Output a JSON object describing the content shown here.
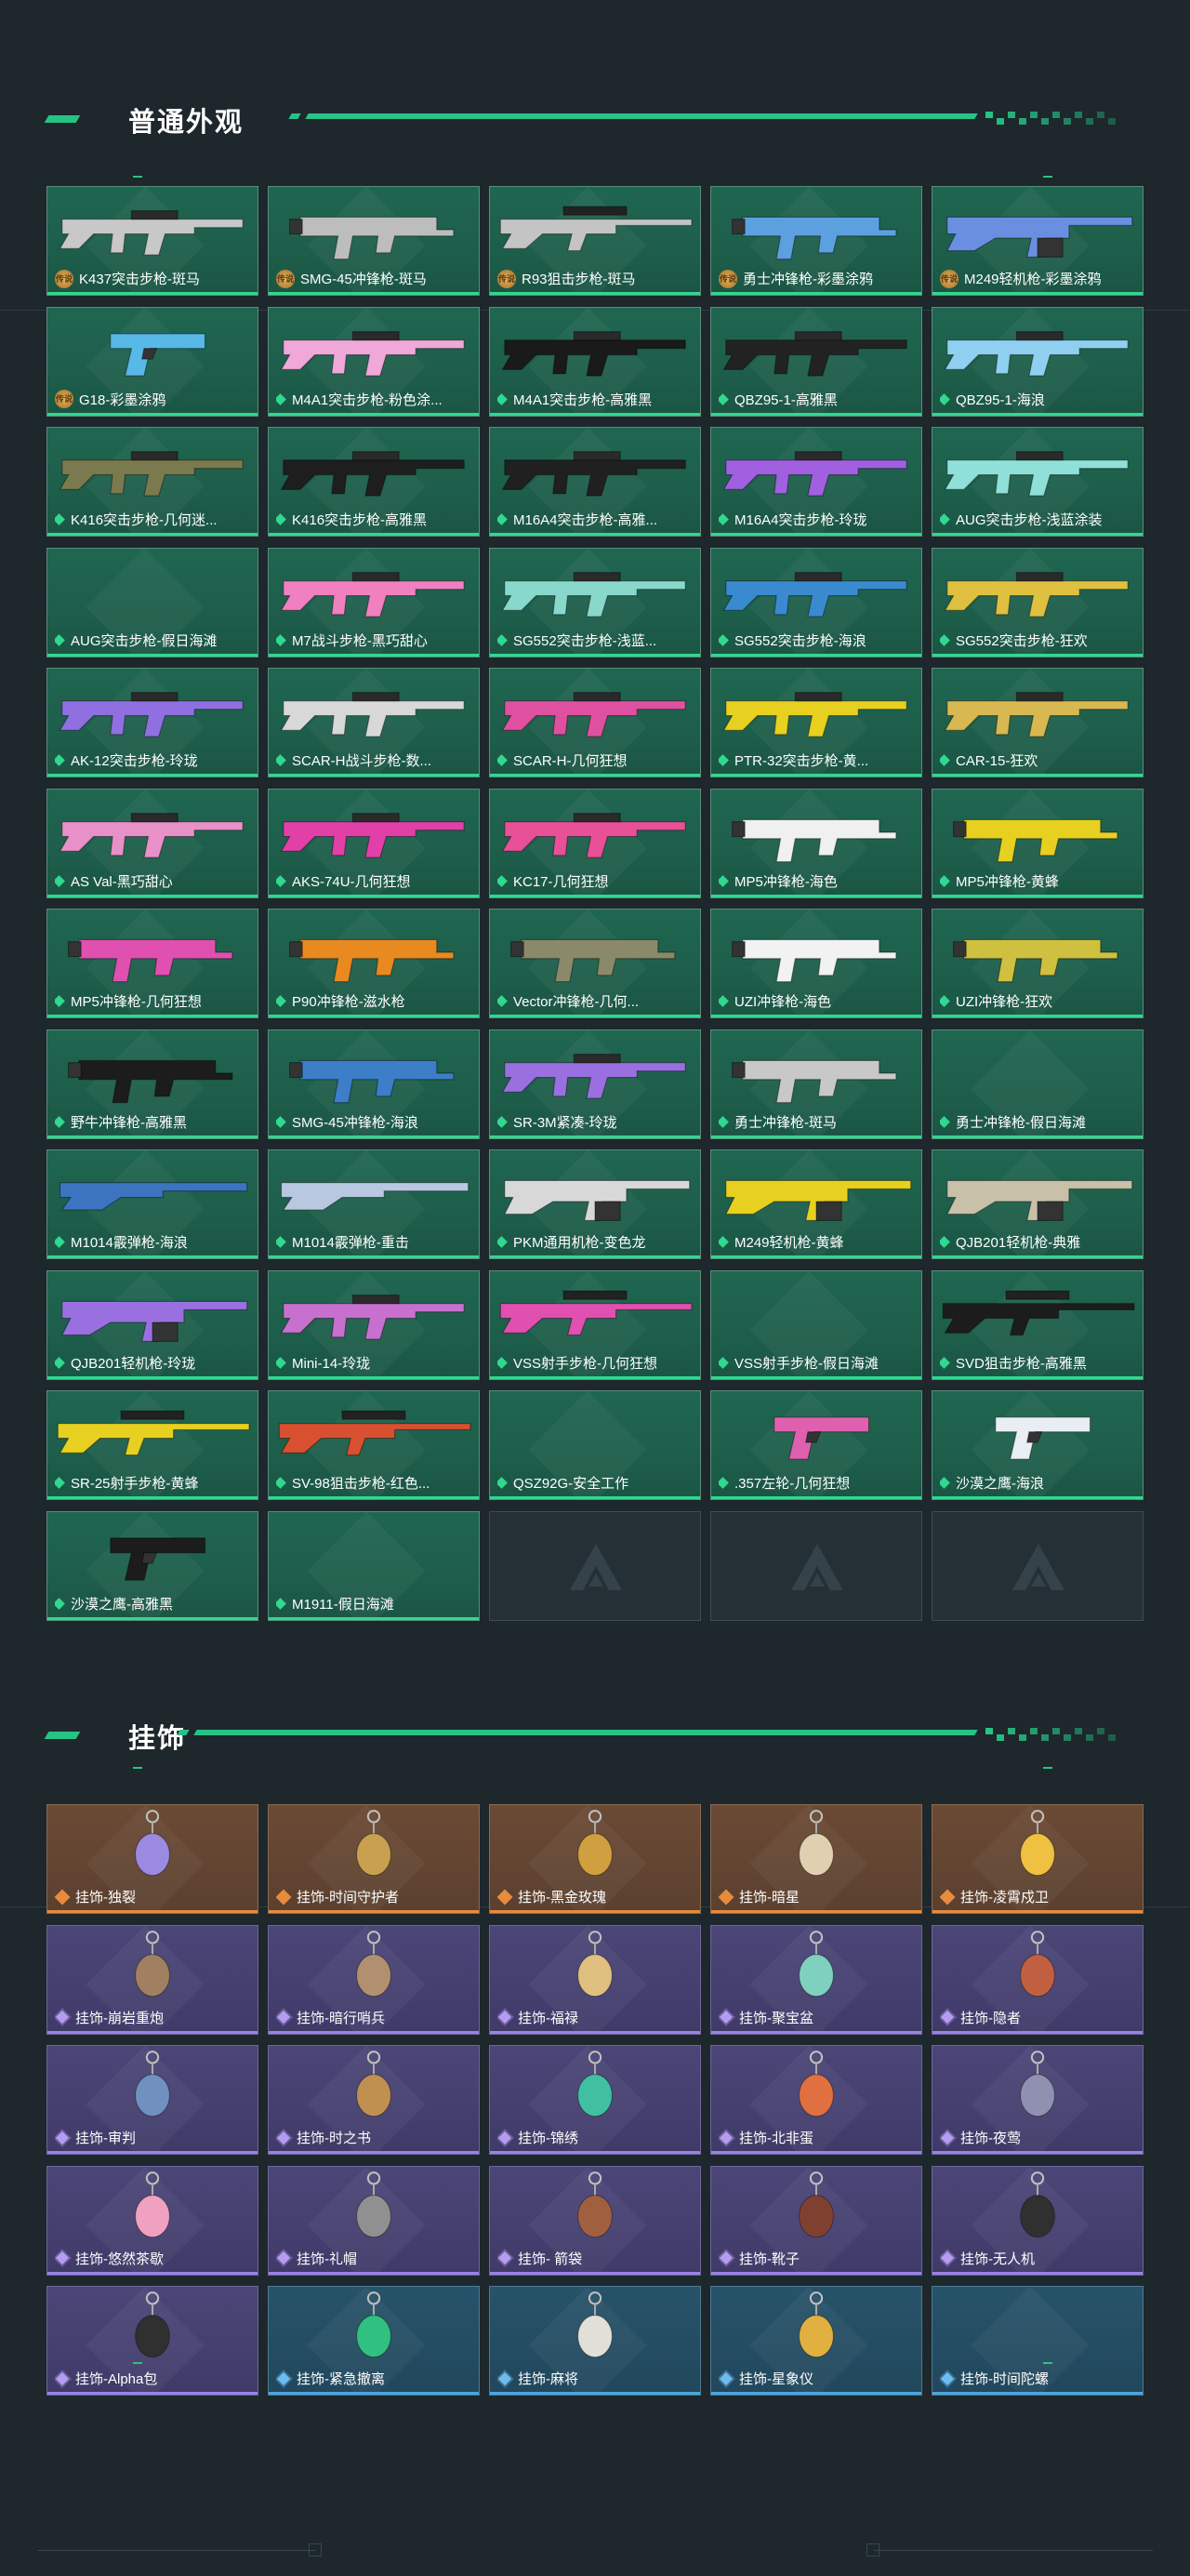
{
  "sections": {
    "skins_title": "普通外观",
    "charms_title": "挂饰"
  },
  "colors": {
    "accent_green": "#27c386",
    "card_green": "#1f6650",
    "card_orange": "#6b4a34",
    "card_purple": "#4c4678",
    "card_blue": "#27536a"
  },
  "skins": [
    {
      "label": "K437突击步枪-斑马",
      "tier": "legendary",
      "icon": "rifle-icon",
      "color": "#c8c8c8"
    },
    {
      "label": "SMG-45冲锋枪-斑马",
      "tier": "legendary",
      "icon": "smg-icon",
      "color": "#bdbdbd"
    },
    {
      "label": "R93狙击步枪-斑马",
      "tier": "legendary",
      "icon": "sniper-icon",
      "color": "#c4c4c4"
    },
    {
      "label": "勇士冲锋枪-彩墨涂鸦",
      "tier": "legendary",
      "icon": "smg-icon",
      "color": "#5da0e0"
    },
    {
      "label": "M249轻机枪-彩墨涂鸦",
      "tier": "legendary",
      "icon": "lmg-icon",
      "color": "#6a8fe0"
    },
    {
      "label": "G18-彩墨涂鸦",
      "tier": "legendary",
      "icon": "pistol-icon",
      "color": "#58b8e8"
    },
    {
      "label": "M4A1突击步枪-粉色涂...",
      "tier": "rare",
      "icon": "rifle-icon",
      "color": "#f0a8d8"
    },
    {
      "label": "M4A1突击步枪-高雅黑",
      "tier": "rare",
      "icon": "rifle-icon",
      "color": "#1a1a1a"
    },
    {
      "label": "QBZ95-1-高雅黑",
      "tier": "rare",
      "icon": "rifle-icon",
      "color": "#222222"
    },
    {
      "label": "QBZ95-1-海浪",
      "tier": "rare",
      "icon": "rifle-icon",
      "color": "#8fd0f0"
    },
    {
      "label": "K416突击步枪-几何迷...",
      "tier": "rare",
      "icon": "rifle-icon",
      "color": "#7a7a4e"
    },
    {
      "label": "K416突击步枪-高雅黑",
      "tier": "rare",
      "icon": "rifle-icon",
      "color": "#1e1e1e"
    },
    {
      "label": "M16A4突击步枪-高雅...",
      "tier": "rare",
      "icon": "rifle-icon",
      "color": "#202020"
    },
    {
      "label": "M16A4突击步枪-玲珑",
      "tier": "rare",
      "icon": "rifle-icon",
      "color": "#a060e0"
    },
    {
      "label": "AUG突击步枪-浅蓝涂装",
      "tier": "rare",
      "icon": "rifle-icon",
      "color": "#8fe0d8"
    },
    {
      "label": "AUG突击步枪-假日海滩",
      "tier": "rare",
      "icon": "rifle-icon",
      "color": ""
    },
    {
      "label": "M7战斗步枪-黑巧甜心",
      "tier": "rare",
      "icon": "rifle-icon",
      "color": "#f080c0"
    },
    {
      "label": "SG552突击步枪-浅蓝...",
      "tier": "rare",
      "icon": "rifle-icon",
      "color": "#88d8cc"
    },
    {
      "label": "SG552突击步枪-海浪",
      "tier": "rare",
      "icon": "rifle-icon",
      "color": "#3a8ad0"
    },
    {
      "label": "SG552突击步枪-狂欢",
      "tier": "rare",
      "icon": "rifle-icon",
      "color": "#e0c040"
    },
    {
      "label": "AK-12突击步枪-玲珑",
      "tier": "rare",
      "icon": "rifle-icon",
      "color": "#9070e0"
    },
    {
      "label": "SCAR-H战斗步枪-数...",
      "tier": "rare",
      "icon": "rifle-icon",
      "color": "#d8d8d8"
    },
    {
      "label": "SCAR-H-几何狂想",
      "tier": "rare",
      "icon": "rifle-icon",
      "color": "#e050a0"
    },
    {
      "label": "PTR-32突击步枪-黄...",
      "tier": "rare",
      "icon": "rifle-icon",
      "color": "#e8d020"
    },
    {
      "label": "CAR-15-狂欢",
      "tier": "rare",
      "icon": "rifle-icon",
      "color": "#d8b850"
    },
    {
      "label": "AS Val-黑巧甜心",
      "tier": "rare",
      "icon": "rifle-icon",
      "color": "#e890c8"
    },
    {
      "label": "AKS-74U-几何狂想",
      "tier": "rare",
      "icon": "rifle-icon",
      "color": "#e040a8"
    },
    {
      "label": "KC17-几何狂想",
      "tier": "rare",
      "icon": "rifle-icon",
      "color": "#e85098"
    },
    {
      "label": "MP5冲锋枪-海色",
      "tier": "rare",
      "icon": "smg-icon",
      "color": "#f0f0f0"
    },
    {
      "label": "MP5冲锋枪-黄蜂",
      "tier": "rare",
      "icon": "smg-icon",
      "color": "#e8d020"
    },
    {
      "label": "MP5冲锋枪-几何狂想",
      "tier": "rare",
      "icon": "smg-icon",
      "color": "#e050b0"
    },
    {
      "label": "P90冲锋枪-滋水枪",
      "tier": "rare",
      "icon": "smg-icon",
      "color": "#e88a20"
    },
    {
      "label": "Vector冲锋枪-几何...",
      "tier": "rare",
      "icon": "smg-icon",
      "color": "#8a8a6a"
    },
    {
      "label": "UZI冲锋枪-海色",
      "tier": "rare",
      "icon": "smg-icon",
      "color": "#f2f2f2"
    },
    {
      "label": "UZI冲锋枪-狂欢",
      "tier": "rare",
      "icon": "smg-icon",
      "color": "#d0c040"
    },
    {
      "label": "野牛冲锋枪-高雅黑",
      "tier": "rare",
      "icon": "smg-icon",
      "color": "#1c1c1c"
    },
    {
      "label": "SMG-45冲锋枪-海浪",
      "tier": "rare",
      "icon": "smg-icon",
      "color": "#3c7ec8"
    },
    {
      "label": "SR-3M紧凑-玲珑",
      "tier": "rare",
      "icon": "rifle-icon",
      "color": "#9a70e0"
    },
    {
      "label": "勇士冲锋枪-斑马",
      "tier": "rare",
      "icon": "smg-icon",
      "color": "#c8c8c8"
    },
    {
      "label": "勇士冲锋枪-假日海滩",
      "tier": "rare",
      "icon": "smg-icon",
      "color": ""
    },
    {
      "label": "M1014霰弹枪-海浪",
      "tier": "rare",
      "icon": "shotgun-icon",
      "color": "#3c74c0"
    },
    {
      "label": "M1014霰弹枪-重击",
      "tier": "rare",
      "icon": "shotgun-icon",
      "color": "#b8c8e0"
    },
    {
      "label": "PKM通用机枪-变色龙",
      "tier": "rare",
      "icon": "lmg-icon",
      "color": "#d8d8d8"
    },
    {
      "label": "M249轻机枪-黄蜂",
      "tier": "rare",
      "icon": "lmg-icon",
      "color": "#e8d020"
    },
    {
      "label": "QJB201轻机枪-典雅",
      "tier": "rare",
      "icon": "lmg-icon",
      "color": "#c8c0a8"
    },
    {
      "label": "QJB201轻机枪-玲珑",
      "tier": "rare",
      "icon": "lmg-icon",
      "color": "#9a70e0"
    },
    {
      "label": "Mini-14-玲珑",
      "tier": "rare",
      "icon": "rifle-icon",
      "color": "#c870d0"
    },
    {
      "label": "VSS射手步枪-几何狂想",
      "tier": "rare",
      "icon": "sniper-icon",
      "color": "#e050b0"
    },
    {
      "label": "VSS射手步枪-假日海滩",
      "tier": "rare",
      "icon": "sniper-icon",
      "color": ""
    },
    {
      "label": "SVD狙击步枪-高雅黑",
      "tier": "rare",
      "icon": "sniper-icon",
      "color": "#1c1c1c"
    },
    {
      "label": "SR-25射手步枪-黄蜂",
      "tier": "rare",
      "icon": "sniper-icon",
      "color": "#e8d020"
    },
    {
      "label": "SV-98狙击步枪-红色...",
      "tier": "rare",
      "icon": "sniper-icon",
      "color": "#d85030"
    },
    {
      "label": "QSZ92G-安全工作",
      "tier": "rare",
      "icon": "pistol-icon",
      "color": ""
    },
    {
      "label": ".357左轮-几何狂想",
      "tier": "rare",
      "icon": "revolver-icon",
      "color": "#e060b0"
    },
    {
      "label": "沙漠之鹰-海浪",
      "tier": "rare",
      "icon": "pistol-icon",
      "color": "#e8eef4"
    },
    {
      "label": "沙漠之鹰-高雅黑",
      "tier": "rare",
      "icon": "pistol-icon",
      "color": "#1c1c1c"
    },
    {
      "label": "M1911-假日海滩",
      "tier": "rare",
      "icon": "pistol-icon",
      "color": ""
    },
    {
      "label": "",
      "tier": "empty",
      "icon": "",
      "color": ""
    },
    {
      "label": "",
      "tier": "empty",
      "icon": "",
      "color": ""
    },
    {
      "label": "",
      "tier": "empty",
      "icon": "",
      "color": ""
    }
  ],
  "charms": [
    {
      "label": "挂饰-独裂",
      "tier": "orange",
      "color": "#9a8ae0"
    },
    {
      "label": "挂饰-时间守护者",
      "tier": "orange",
      "color": "#c8a050"
    },
    {
      "label": "挂饰-黑金玫瑰",
      "tier": "orange",
      "color": "#d0a040"
    },
    {
      "label": "挂饰-暗星",
      "tier": "orange",
      "color": "#e0d0b0"
    },
    {
      "label": "挂饰-凌霄戍卫",
      "tier": "orange",
      "color": "#f0c040"
    },
    {
      "label": "挂饰-崩岩重炮",
      "tier": "purple",
      "color": "#a08060"
    },
    {
      "label": "挂饰-暗行哨兵",
      "tier": "purple",
      "color": "#b09070"
    },
    {
      "label": "挂饰-福禄",
      "tier": "purple",
      "color": "#e0c080"
    },
    {
      "label": "挂饰-聚宝盆",
      "tier": "purple",
      "color": "#80d0c0"
    },
    {
      "label": "挂饰-隐者",
      "tier": "purple",
      "color": "#c06040"
    },
    {
      "label": "挂饰-审判",
      "tier": "purple",
      "color": "#7090c0"
    },
    {
      "label": "挂饰-时之书",
      "tier": "purple",
      "color": "#c09050"
    },
    {
      "label": "挂饰-锦绣",
      "tier": "purple",
      "color": "#40c0a0"
    },
    {
      "label": "挂饰-北非蛋",
      "tier": "purple",
      "color": "#e07040"
    },
    {
      "label": "挂饰-夜莺",
      "tier": "purple",
      "color": "#9090b0"
    },
    {
      "label": "挂饰-悠然茶歇",
      "tier": "purple",
      "color": "#f0a0c0"
    },
    {
      "label": "挂饰-礼帽",
      "tier": "purple",
      "color": "#909090"
    },
    {
      "label": "挂饰- 箭袋",
      "tier": "purple",
      "color": "#a06040"
    },
    {
      "label": "挂饰-靴子",
      "tier": "purple",
      "color": "#804030"
    },
    {
      "label": "挂饰-无人机",
      "tier": "purple",
      "color": "#303030"
    },
    {
      "label": "挂饰-Alpha包",
      "tier": "purple",
      "color": "#303030"
    },
    {
      "label": "挂饰-紧急撤离",
      "tier": "blue",
      "color": "#30c080"
    },
    {
      "label": "挂饰-麻将",
      "tier": "blue",
      "color": "#e0e0d8"
    },
    {
      "label": "挂饰-星象仪",
      "tier": "blue",
      "color": "#e0b040"
    },
    {
      "label": "挂饰-时间陀螺",
      "tier": "blue",
      "color": ""
    }
  ],
  "badges": {
    "legendary_text": "传说"
  }
}
